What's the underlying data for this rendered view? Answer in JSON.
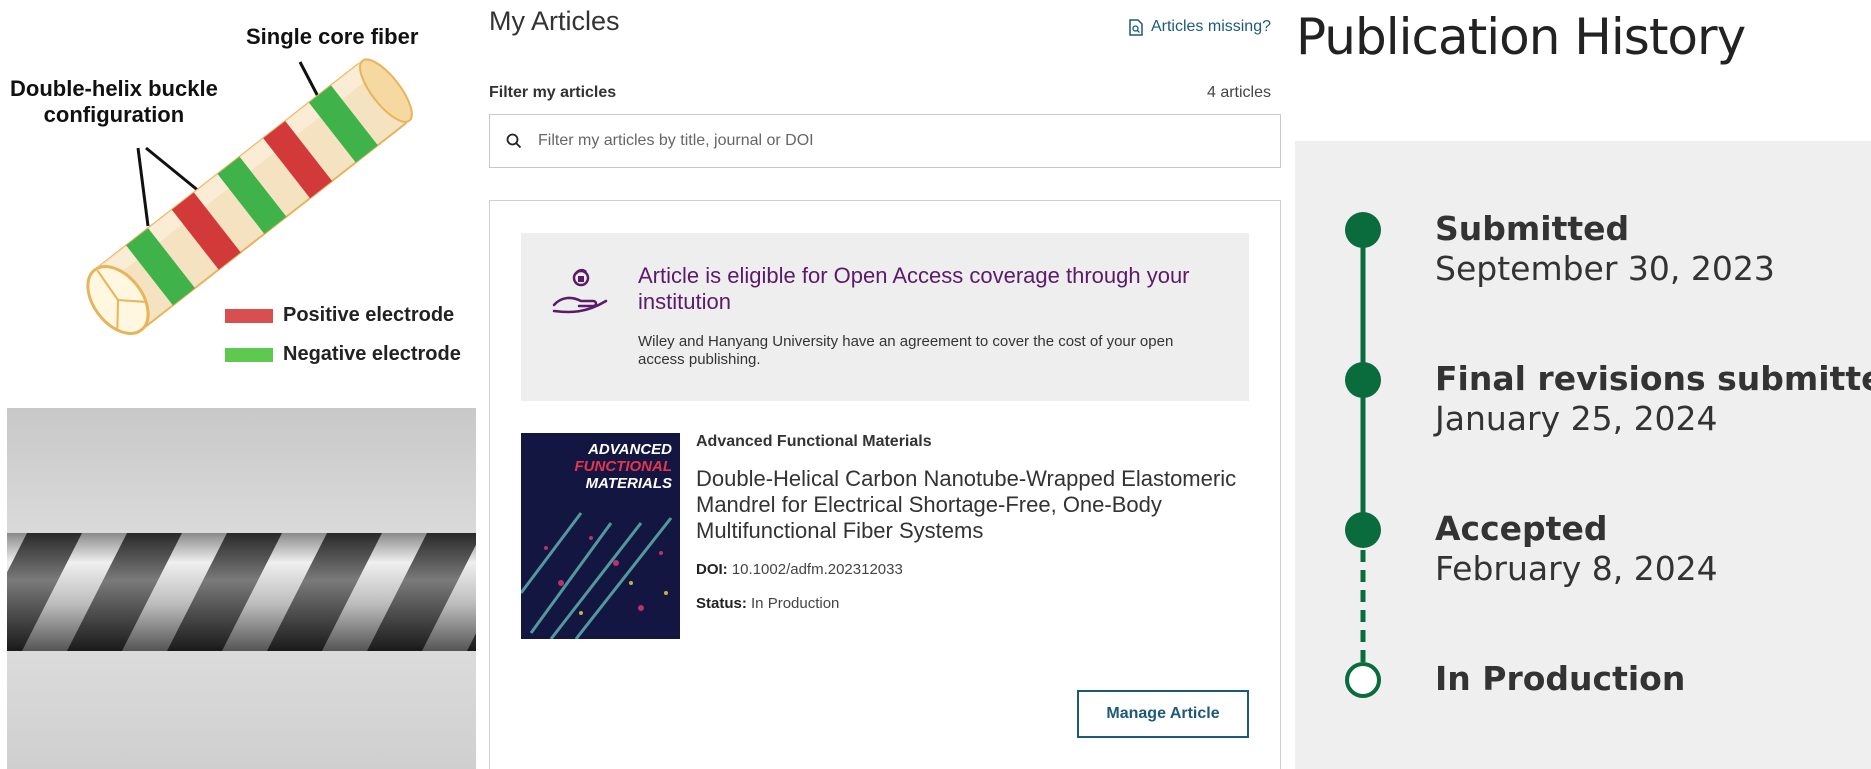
{
  "figure": {
    "label_single_core": "Single core fiber",
    "label_double_helix": "Double-helix buckle\nconfiguration",
    "legend": [
      {
        "label": "Positive electrode",
        "color": "#d94f4f"
      },
      {
        "label": "Negative electrode",
        "color": "#5dc94e"
      }
    ]
  },
  "articles": {
    "title": "My Articles",
    "missing_link": "Articles missing?",
    "filter_label": "Filter my articles",
    "count": "4 articles",
    "search_placeholder": "Filter my articles by title, journal or DOI",
    "oa_banner": {
      "title": "Article is eligible for Open Access coverage through your institution",
      "text": "Wiley and Hanyang University have an agreement to cover the cost of your open access publishing."
    },
    "article": {
      "cover_text": [
        "ADVANCED",
        "FUNCTIONAL",
        "MATERIALS"
      ],
      "journal": "Advanced Functional Materials",
      "title": "Double-Helical Carbon Nanotube-Wrapped Elastomeric Mandrel for Electrical Shortage-Free, One-Body Multifunctional Fiber Systems",
      "doi_label": "DOI:",
      "doi": "10.1002/adfm.202312033",
      "status_label": "Status:",
      "status": "In Production"
    },
    "manage_button": "Manage Article"
  },
  "history": {
    "title": "Publication History",
    "accent_color": "#0a6b3d",
    "steps": [
      {
        "label": "Submitted",
        "date": "September 30, 2023",
        "done": true
      },
      {
        "label": "Final revisions submitted",
        "date": "January 25, 2024",
        "done": true
      },
      {
        "label": "Accepted",
        "date": "February 8, 2024",
        "done": true
      },
      {
        "label": "In Production",
        "date": "",
        "done": false
      }
    ]
  }
}
